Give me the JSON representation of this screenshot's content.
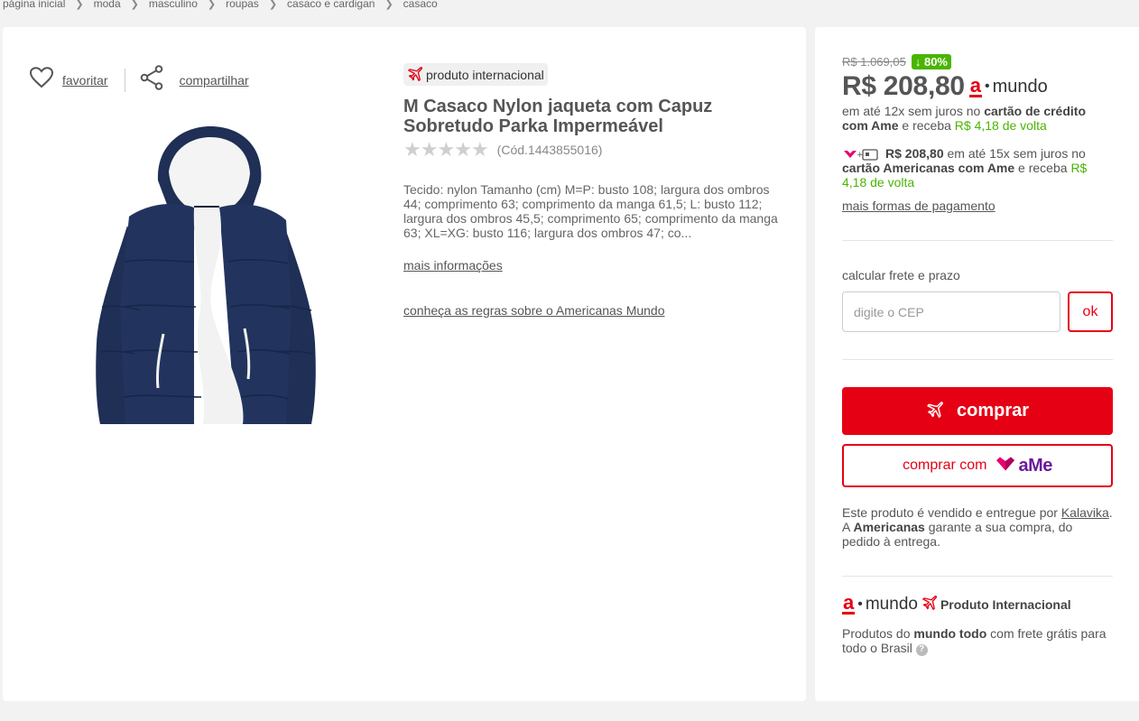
{
  "breadcrumb": [
    "página inicial",
    "moda",
    "masculino",
    "roupas",
    "casaco e cardigan",
    "casaco"
  ],
  "actions": {
    "favorite_label": "favoritar",
    "share_label": "compartilhar"
  },
  "product": {
    "intl_badge": "produto internacional",
    "title": "M Casaco Nylon jaqueta com Capuz Sobretudo Parka Impermeável",
    "rating_stars": 0,
    "code": "(Cód.1443855016)",
    "description": "Tecido: nylon Tamanho (cm) M=P: busto 108; largura dos ombros 44; comprimento 63; comprimento da manga 61,5; L: busto 112; largura dos ombros 45,5; comprimento 65; comprimento da manga 63; XL=XG: busto 116; largura dos ombros 47; co...",
    "more_info": "mais informações",
    "rules_link": "conheça as regras sobre o Americanas Mundo"
  },
  "pricing": {
    "old_price": "R$ 1.069,05",
    "discount": "80%",
    "price": "R$ 208,80",
    "mundo_a": "a",
    "mundo_word": "mundo",
    "inst1_pre": "em até 12x sem juros no ",
    "inst1_bold": "cartão de crédito com Ame",
    "inst1_mid": " e receba ",
    "inst1_cash": "R$ 4,18 de volta",
    "inst2_price": "R$ 208,80",
    "inst2_pre": " em até 15x sem juros no ",
    "inst2_bold": "cartão Americanas com Ame",
    "inst2_mid": " e receba ",
    "inst2_cash": "R$ 4,18 de volta",
    "more_payments": "mais formas de pagamento"
  },
  "shipping": {
    "label": "calcular frete e prazo",
    "cep_placeholder": "digite o CEP",
    "ok_label": "ok"
  },
  "buttons": {
    "buy": "comprar",
    "buy_with": "comprar com",
    "ame_word": "aMe"
  },
  "seller": {
    "pre": "Este produto é vendido e entregue por ",
    "name": "Kalavika",
    "dot": ".",
    "mid1": " A ",
    "brand": "Americanas",
    "post": " garante a sua compra, do pedido à entrega."
  },
  "mundo_section": {
    "prod_intl": "Produto Internacional",
    "free_pre": "Produtos do ",
    "free_bold": "mundo todo",
    "free_post": " com frete grátis para todo o Brasil",
    "help": "?"
  },
  "colors": {
    "brand_red": "#e60014",
    "discount_green": "#49b500",
    "ame_purple": "#6a1b9a"
  }
}
